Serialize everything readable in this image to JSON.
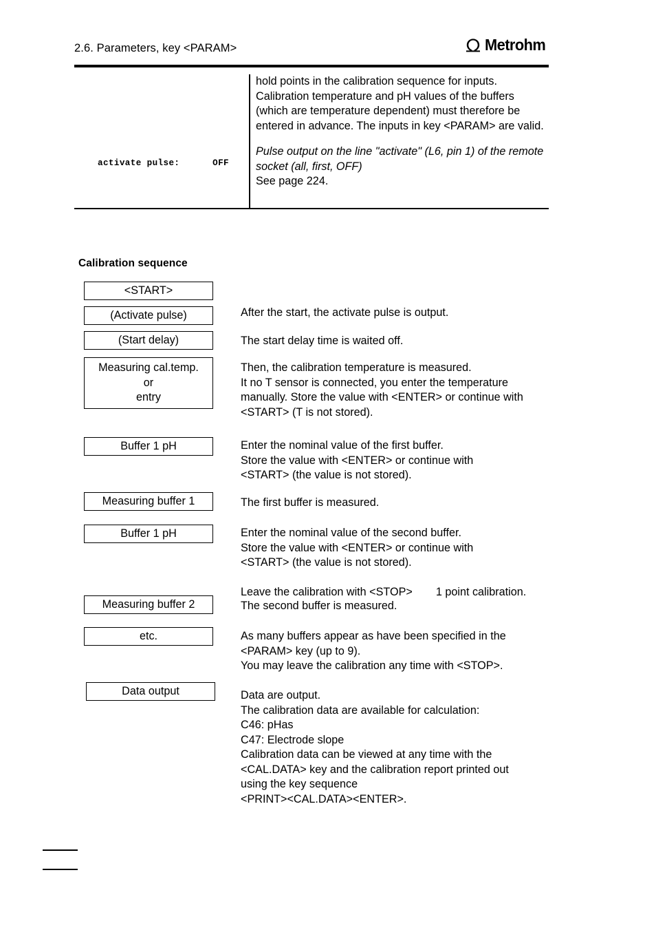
{
  "header": {
    "title": "2.6. Parameters, key <PARAM>",
    "brand": "Metrohm",
    "logo_icon": "omega-arch-icon"
  },
  "param_table": {
    "left_code_label": "activate pulse:",
    "left_code_value": "OFF",
    "left_code_line": "activate pulse:      OFF",
    "right_paragraph_1": "hold points in the calibration sequence for inputs. Calibration temperature and pH values of the buffers (which are temperature dependent) must therefore be entered in advance. The inputs in key <PARAM> are valid.",
    "right_paragraph_2_italic": "Pulse output on the line \"activate\" (L6, pin 1) of the remote socket (all, first, OFF)",
    "right_paragraph_3": "See page 224."
  },
  "section": {
    "heading": "Calibration sequence"
  },
  "flow": {
    "steps": [
      {
        "box": "<START>",
        "note": ""
      },
      {
        "box": "(Activate pulse)",
        "note": "After the start, the activate pulse is output."
      },
      {
        "box": "(Start delay)",
        "note": "The start delay time is waited off."
      },
      {
        "box_lines": [
          "Measuring cal.temp.",
          "or",
          "entry"
        ],
        "note": "Then, the calibration temperature is measured.\nIt no T sensor is connected, you enter the temperature\nmanually. Store the value with <ENTER> or continue with\n<START> (T is not stored)."
      },
      {
        "box": "Buffer 1 pH",
        "note": "Enter the nominal value of the first buffer.\nStore the value  with <ENTER> or continue with\n<START> (the value is not stored)."
      },
      {
        "box": "Measuring buffer 1",
        "note": "The first buffer is measured."
      },
      {
        "box": "Buffer 1 pH",
        "note_a": "Enter the nominal value of the second buffer.\nStore the value  with <ENTER> or continue with\n<START> (the value is not stored).",
        "note_b": "Leave the calibration with <STOP>",
        "note_c": "1 point calibration."
      },
      {
        "box": "Measuring buffer 2",
        "note": "The second buffer is measured."
      },
      {
        "box": "etc.",
        "note": "As many buffers appear as have been specified in the\n<PARAM> key (up to 9).\nYou may leave the calibration any time with <STOP>."
      },
      {
        "box": "Data output",
        "note": "Data are output.\nThe calibration data are available for calculation:\nC46: pHas\nC47: Electrode slope\nCalibration data can be viewed at any time with the\n<CAL.DATA> key and the calibration report printed out\nusing the key sequence\n<PRINT><CAL.DATA><ENTER>."
      }
    ]
  }
}
